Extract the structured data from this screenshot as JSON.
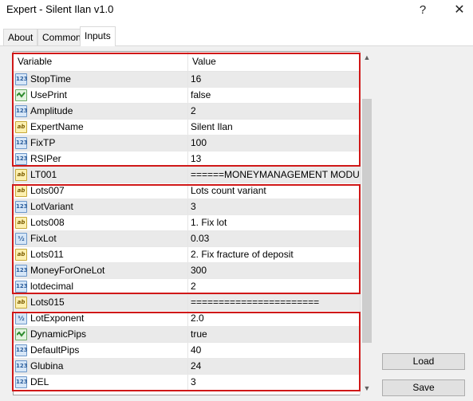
{
  "window": {
    "title": "Expert - Silent Ilan v1.0",
    "help_glyph": "?",
    "close_glyph": "✕"
  },
  "tabs": [
    {
      "label": "About"
    },
    {
      "label": "Common"
    },
    {
      "label": "Inputs"
    }
  ],
  "grid": {
    "headers": {
      "variable": "Variable",
      "value": "Value"
    },
    "rows": [
      {
        "name": "StopTime",
        "value": "16",
        "type": "int"
      },
      {
        "name": "UsePrint",
        "value": "false",
        "type": "bool"
      },
      {
        "name": "Amplitude",
        "value": "2",
        "type": "int"
      },
      {
        "name": "ExpertName",
        "value": "Silent Ilan",
        "type": "string"
      },
      {
        "name": "FixTP",
        "value": "100",
        "type": "int"
      },
      {
        "name": "RSIPer",
        "value": "13",
        "type": "int"
      },
      {
        "name": "LT001",
        "value": "======MONEYMANAGEMENT MODULE...",
        "type": "string"
      },
      {
        "name": "Lots007",
        "value": "Lots count variant",
        "type": "string"
      },
      {
        "name": "LotVariant",
        "value": "3",
        "type": "int"
      },
      {
        "name": "Lots008",
        "value": "1. Fix lot",
        "type": "string"
      },
      {
        "name": "FixLot",
        "value": "0.03",
        "type": "double"
      },
      {
        "name": "Lots011",
        "value": "2. Fix fracture of deposit",
        "type": "string"
      },
      {
        "name": "MoneyForOneLot",
        "value": "300",
        "type": "int"
      },
      {
        "name": "lotdecimal",
        "value": "2",
        "type": "int"
      },
      {
        "name": "Lots015",
        "value": "=======================",
        "type": "string"
      },
      {
        "name": "LotExponent",
        "value": "2.0",
        "type": "double"
      },
      {
        "name": "DynamicPips",
        "value": "true",
        "type": "bool"
      },
      {
        "name": "DefaultPips",
        "value": "40",
        "type": "int"
      },
      {
        "name": "Glubina",
        "value": "24",
        "type": "int"
      },
      {
        "name": "DEL",
        "value": "3",
        "type": "int"
      }
    ]
  },
  "buttons": {
    "load": "Load",
    "save": "Save"
  },
  "icon_glyphs": {
    "int": "123",
    "string": "ab",
    "double": "½"
  },
  "colors": {
    "highlight": "#d01818",
    "row_alt": "#eaeaea"
  }
}
